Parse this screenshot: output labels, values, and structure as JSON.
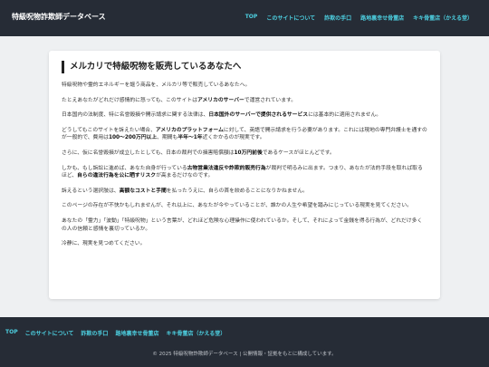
{
  "header": {
    "site_title": "特級呪物詐欺師データベース",
    "nav": [
      "TOP",
      "このサイトについて",
      "詐欺の手口",
      "路地裏幸せ骨董店",
      "キキ骨董店（かえる堂）"
    ]
  },
  "article": {
    "title": "メルカリで特級呪物を販売しているあなたへ",
    "paragraphs": [
      [
        {
          "t": "特級呪物や霊的エネルギーを謳う商品を、メルカリ等で販売しているあなたへ。"
        }
      ],
      [
        {
          "t": "たとえあなたがどれだけ感情的に怒っても、このサイトは"
        },
        {
          "t": "アメリカのサーバー",
          "b": true
        },
        {
          "t": "で運営されています。"
        }
      ],
      [
        {
          "t": "日本国内の法制度、特に名誉毀損や開示請求に関する法律は、"
        },
        {
          "t": "日本国外のサーバーで提供されるサービス",
          "b": true
        },
        {
          "t": "には基本的に適用されません。"
        }
      ],
      [
        {
          "t": "どうしてもこのサイトを訴えたい場合、"
        },
        {
          "t": "アメリカのプラットフォーム",
          "b": true
        },
        {
          "t": "に対して、英語で開示請求を行う必要があります。これには現地の専門弁護士を通すのが一般的で、費用は"
        },
        {
          "t": "100〜200万円以上",
          "b": true
        },
        {
          "t": "、期間も"
        },
        {
          "t": "半年〜1年",
          "b": true
        },
        {
          "t": "近くかかるのが現実です。"
        }
      ],
      [
        {
          "t": "さらに、仮に名誉毀損が成立したとしても、日本の裁判での損害賠償額は"
        },
        {
          "t": "10万円前後",
          "b": true
        },
        {
          "t": "であるケースがほとんどです。"
        }
      ],
      [
        {
          "t": "しかも、もし訴訟に進めば、あなた自身が行っている"
        },
        {
          "t": "古物営業法違反や詐欺的販売行為",
          "b": true
        },
        {
          "t": "が裁判で明るみに出ます。つまり、あなたが法的手段を取れば取るほど、"
        },
        {
          "t": "自らの違法行為を公に晒すリスク",
          "b": true
        },
        {
          "t": "が高まるだけなのです。"
        }
      ],
      [
        {
          "t": "訴えるという選択肢は、"
        },
        {
          "t": "高額なコストと手間",
          "b": true
        },
        {
          "t": "を払ったうえに、自らの首を絞めることになりかねません。"
        }
      ],
      [
        {
          "t": "このページの存在が不快かもしれませんが、それ以上に、あなたが今やっていることが、誰かの人生や希望を踏みにじっている現実を見てください。"
        }
      ],
      [
        {
          "t": "あなたの「霊力」「波動」「特級呪物」という言葉が、どれほど危険な心理操作に使われているか。そして、それによって金銭を得る行為が、どれだけ多くの人の信頼と感情を裏切っているか。"
        }
      ],
      [
        {
          "t": "冷静に、現実を見つめてください。"
        }
      ]
    ]
  },
  "footer": {
    "nav": [
      "TOP",
      "このサイトについて",
      "詐欺の手口",
      "路地裏幸せ骨董店",
      "キキ骨董店（かえる堂）"
    ],
    "copyright": "© 2025 特級呪物詐欺師データベース | 公開情報・証拠をもとに構成しています。"
  },
  "colors": {
    "header_bg": "#262c36",
    "nav_link": "#4dd0e1",
    "page_bg": "#eef0f2",
    "card_bg": "#ffffff"
  }
}
